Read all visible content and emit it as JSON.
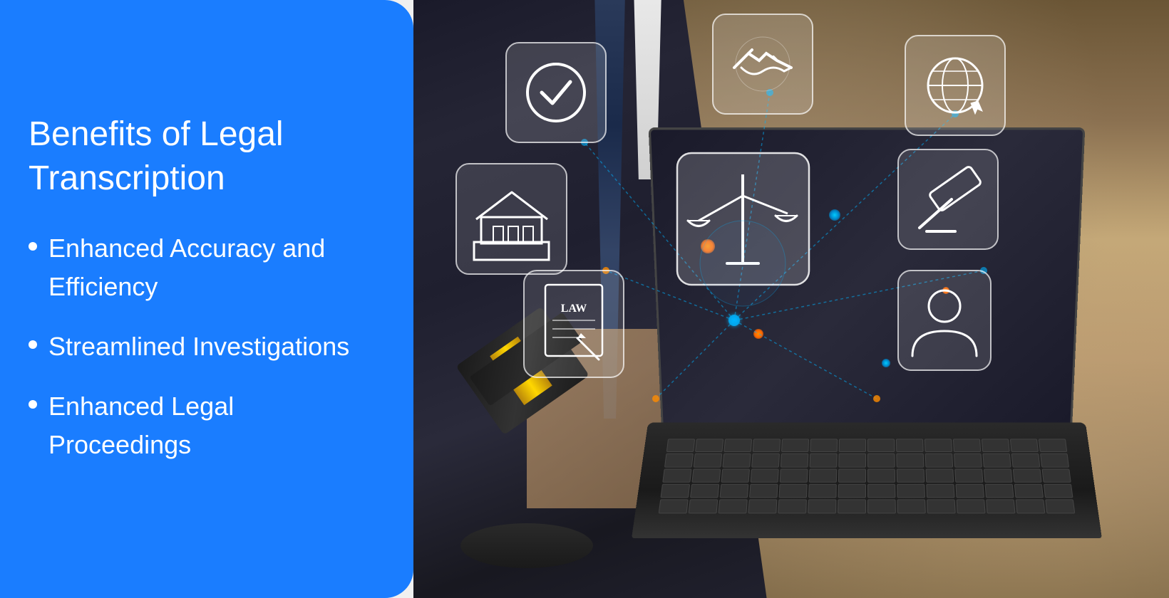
{
  "left_panel": {
    "title": "Benefits of Legal Transcription",
    "background_color": "#1a7dff",
    "items": [
      {
        "id": "item-1",
        "text": "Enhanced Accuracy and Efficiency"
      },
      {
        "id": "item-2",
        "text": "Streamlined Investigations"
      },
      {
        "id": "item-3",
        "text": "Enhanced Legal Proceedings"
      }
    ]
  },
  "right_panel": {
    "description": "Legal professional using laptop with floating legal icons",
    "icons": [
      {
        "id": "checkmark-icon",
        "label": "Checkmark",
        "symbol": "✓",
        "position": "top-left"
      },
      {
        "id": "handshake-icon",
        "label": "Handshake",
        "symbol": "🤝",
        "position": "top-center"
      },
      {
        "id": "globe-icon",
        "label": "Globe",
        "symbol": "🌐",
        "position": "top-right"
      },
      {
        "id": "building-icon",
        "label": "Building/Court",
        "symbol": "🏛",
        "position": "mid-left"
      },
      {
        "id": "scales-icon",
        "label": "Scales of Justice",
        "symbol": "⚖",
        "position": "center"
      },
      {
        "id": "gavel-icon",
        "label": "Gavel/Hammer",
        "symbol": "⚖",
        "position": "mid-right"
      },
      {
        "id": "document-icon",
        "label": "Law Document",
        "symbol": "📄",
        "position": "bottom-left"
      },
      {
        "id": "person-icon",
        "label": "Person",
        "symbol": "👤",
        "position": "bottom-right"
      }
    ]
  }
}
